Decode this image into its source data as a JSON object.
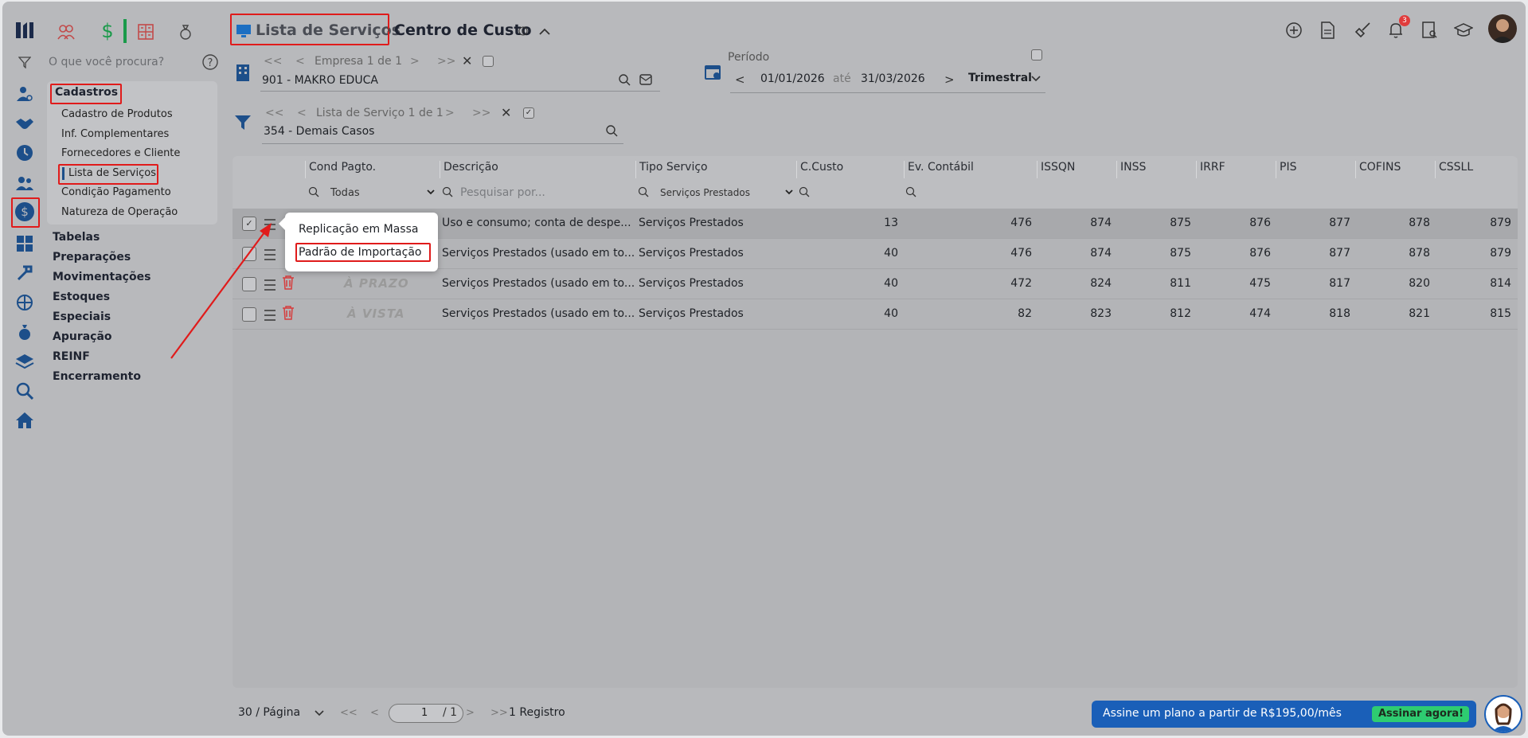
{
  "topnav": {
    "dollar_icon": "$"
  },
  "breadcrumb": {
    "current": "Lista de Serviços",
    "next": "Centro de Custo"
  },
  "search": {
    "placeholder": "O que você procura?"
  },
  "sidebar_menu": {
    "active_section": "Cadastros",
    "items": [
      "Cadastro de Produtos",
      "Inf. Complementares",
      "Fornecedores e Cliente",
      "Lista de Serviços",
      "Condição Pagamento",
      "Natureza de Operação"
    ],
    "sections": [
      "Tabelas",
      "Preparações",
      "Movimentações",
      "Estoques",
      "Especiais",
      "Apuração",
      "REINF",
      "Encerramento"
    ]
  },
  "empresa": {
    "nav_label": "Empresa 1 de 1",
    "value": "901 - MAKRO EDUCA"
  },
  "periodo": {
    "label": "Período",
    "start": "01/01/2026",
    "sep": "até",
    "end": "31/03/2026",
    "mode": "Trimestral"
  },
  "lista_servico": {
    "nav_label": "Lista de Serviço 1 de 1",
    "value": "354 - Demais Casos"
  },
  "nav_glyphs": {
    "first": "<<",
    "prev": "<",
    "next": ">",
    "last": ">>"
  },
  "table": {
    "columns": [
      "Cond Pagto.",
      "Descrição",
      "Tipo Serviço",
      "C.Custo",
      "Ev. Contábil",
      "ISSQN",
      "INSS",
      "IRRF",
      "PIS",
      "COFINS",
      "CSSLL"
    ],
    "filters": {
      "cond": "Todas",
      "descricao_placeholder": "Pesquisar por...",
      "tipo": "Serviços Prestados"
    },
    "rows": [
      {
        "cond": "",
        "descricao": "Uso e consumo; conta de despe...",
        "tipo": "Serviços Prestados",
        "ccusto": "13",
        "ev": "476",
        "issqn": "874",
        "inss": "875",
        "irrf": "876",
        "pis": "877",
        "cofins": "878",
        "cssll": "879"
      },
      {
        "cond": "",
        "descricao": "Serviços Prestados (usado em to...",
        "tipo": "Serviços Prestados",
        "ccusto": "40",
        "ev": "476",
        "issqn": "874",
        "inss": "875",
        "irrf": "876",
        "pis": "877",
        "cofins": "878",
        "cssll": "879"
      },
      {
        "cond": "À PRAZO",
        "descricao": "Serviços Prestados (usado em to...",
        "tipo": "Serviços Prestados",
        "ccusto": "40",
        "ev": "472",
        "issqn": "824",
        "inss": "811",
        "irrf": "475",
        "pis": "817",
        "cofins": "820",
        "cssll": "814"
      },
      {
        "cond": "À VISTA",
        "descricao": "Serviços Prestados (usado em to...",
        "tipo": "Serviços Prestados",
        "ccusto": "40",
        "ev": "82",
        "issqn": "823",
        "inss": "812",
        "irrf": "474",
        "pis": "818",
        "cofins": "821",
        "cssll": "815"
      }
    ]
  },
  "context_menu": {
    "items": [
      "Replicação em Massa",
      "Padrão de Importação"
    ]
  },
  "pagination": {
    "per_page": "30 / Página",
    "page": "1",
    "total": "/ 1",
    "records": "1 Registro"
  },
  "banner": {
    "text": "Assine um plano a partir de R$195,00/mês",
    "cta": "Assinar agora!"
  },
  "notifications": {
    "count": "3"
  },
  "colors": {
    "accent": "#1d4f8a",
    "highlight": "#e01b1b",
    "banner": "#1a5fb8",
    "cta": "#2ecc71"
  }
}
